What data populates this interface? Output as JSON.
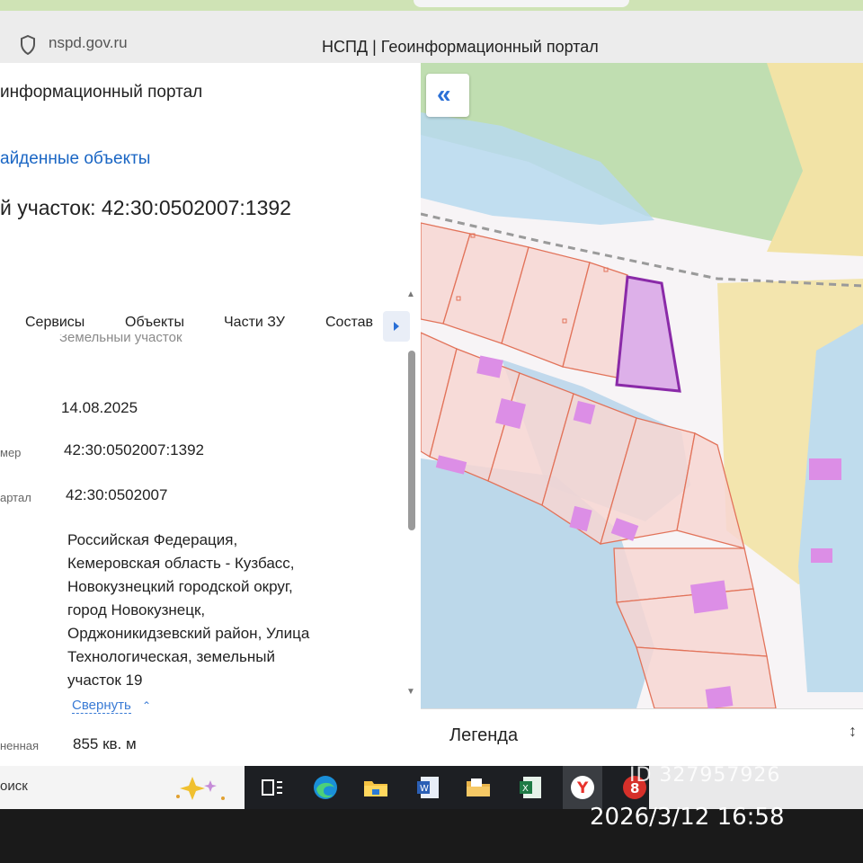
{
  "browser": {
    "url": "nspd.gov.ru",
    "page_title": "НСПД | Геоинформационный портал"
  },
  "panel": {
    "portal_title": "информационный портал",
    "found_objects_link": "айденные объекты",
    "heading": "й участок: 42:30:0502007:1392",
    "tabs": [
      "Сервисы",
      "Объекты",
      "Части ЗУ",
      "Состав"
    ],
    "cut_text": "Земельный участок",
    "rows": [
      {
        "label": "",
        "value": "14.08.2025"
      },
      {
        "label": "мер",
        "value": "42:30:0502007:1392"
      },
      {
        "label": "артал",
        "value": "42:30:0502007"
      }
    ],
    "address_lines": [
      "Российская Федерация,",
      "Кемеровская область - Кузбасс,",
      "Новокузнецкий городской округ,",
      "город Новокузнецк,",
      "Орджоникидзевский район, Улица",
      "Технологическая, земельный",
      "участок 19"
    ],
    "collapse_label": "Свернуть",
    "area_label": "ненная",
    "area_value": "855 кв. м"
  },
  "map": {
    "legend_label": "Легенда",
    "colors": {
      "parcel_fill": "#f6d7d3",
      "parcel_stroke": "#e07a5f",
      "selected_fill": "#d9a8e8",
      "selected_stroke": "#8a2aa8",
      "building": "#dc8ee6",
      "zone_green": "#b5d9a8",
      "zone_blue": "#bcd8ea",
      "zone_yellow": "#f2e3a6"
    }
  },
  "taskbar": {
    "search_label": "оиск"
  },
  "overlay": {
    "watermark": "ID 327957926",
    "timestamp": "2026/3/12 16:58"
  }
}
